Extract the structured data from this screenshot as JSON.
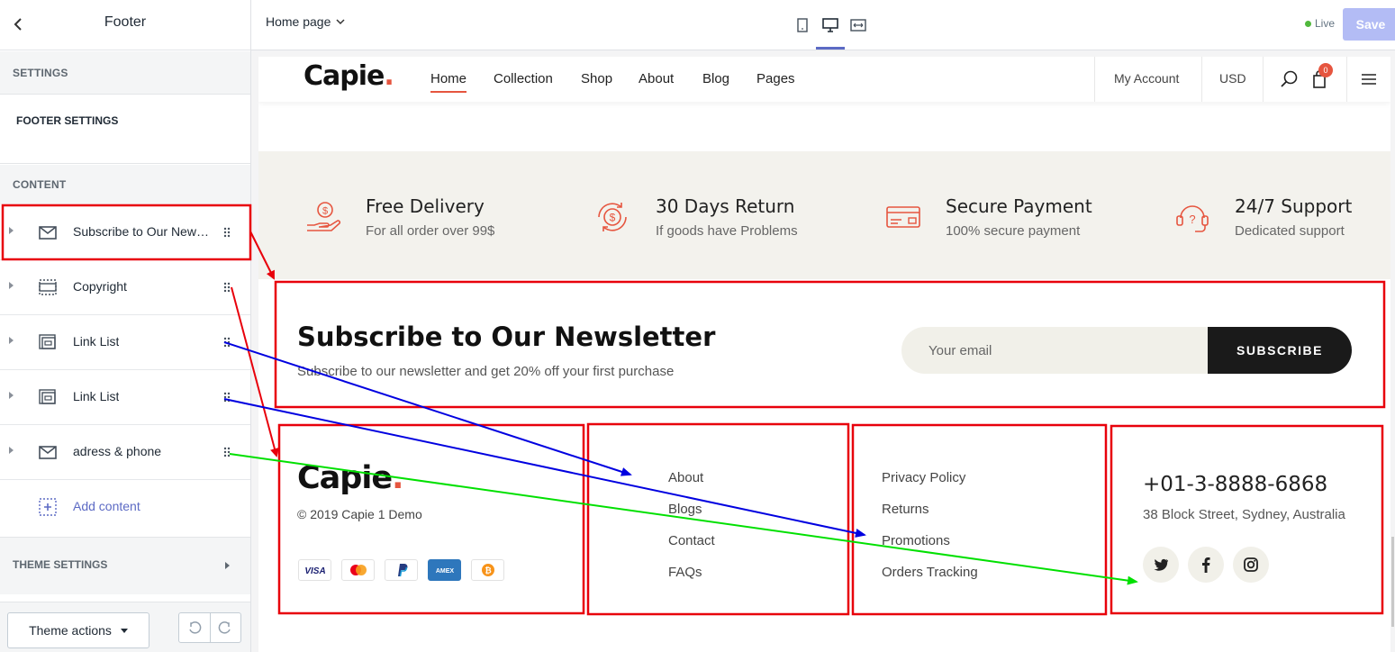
{
  "sidebar": {
    "title": "Footer",
    "settings_label": "SETTINGS",
    "footer_settings_label": "FOOTER SETTINGS",
    "content_label": "CONTENT",
    "items": [
      {
        "label": "Subscribe to Our Newsletter",
        "icon": "envelope-icon"
      },
      {
        "label": "Copyright",
        "icon": "section-dashed-icon"
      },
      {
        "label": "Link List",
        "icon": "link-list-icon"
      },
      {
        "label": "Link List",
        "icon": "link-list-icon"
      },
      {
        "label": "adress & phone",
        "icon": "envelope-icon"
      }
    ],
    "add_content": "Add content",
    "theme_settings": "THEME SETTINGS",
    "theme_actions": "Theme actions"
  },
  "topbar": {
    "page": "Home page",
    "live": "Live",
    "save": "Save",
    "active_device": "desktop"
  },
  "store": {
    "logo": "Capie",
    "logo_dot": ".",
    "nav": [
      "Home",
      "Collection",
      "Shop",
      "About",
      "Blog",
      "Pages"
    ],
    "my_account": "My Account",
    "currency": "USD",
    "cart_count": "0",
    "features": [
      {
        "title": "Free Delivery",
        "sub": "For all order over 99$",
        "icon": "money-hand-icon"
      },
      {
        "title": "30 Days Return",
        "sub": "If goods have Problems",
        "icon": "return-coin-icon"
      },
      {
        "title": "Secure Payment",
        "sub": "100% secure payment",
        "icon": "credit-card-icon"
      },
      {
        "title": "24/7 Support",
        "sub": "Dedicated support",
        "icon": "headset-icon"
      }
    ],
    "newsletter": {
      "title": "Subscribe to Our Newsletter",
      "subtitle": "Subscribe to our newsletter and get 20% off your first purchase",
      "placeholder": "Your email",
      "button": "SUBSCRIBE"
    },
    "footer": {
      "copyright": "© 2019 Capie 1 Demo",
      "payments": [
        "VISA",
        "mastercard",
        "PayPal",
        "AMEX",
        "bitcoin"
      ],
      "links_1": [
        "About",
        "Blogs",
        "Contact",
        "FAQs"
      ],
      "links_2": [
        "Privacy Policy",
        "Returns",
        "Promotions",
        "Orders Tracking"
      ],
      "phone": "+01-3-8888-6868",
      "address": "38 Block Street, Sydney, Australia",
      "social": [
        "twitter-icon",
        "facebook-icon",
        "instagram-icon"
      ]
    }
  },
  "annotation_colors": {
    "box": "#e8000b",
    "blue": "#0000e0",
    "green": "#00e000",
    "red_arrow": "#e8000b"
  }
}
